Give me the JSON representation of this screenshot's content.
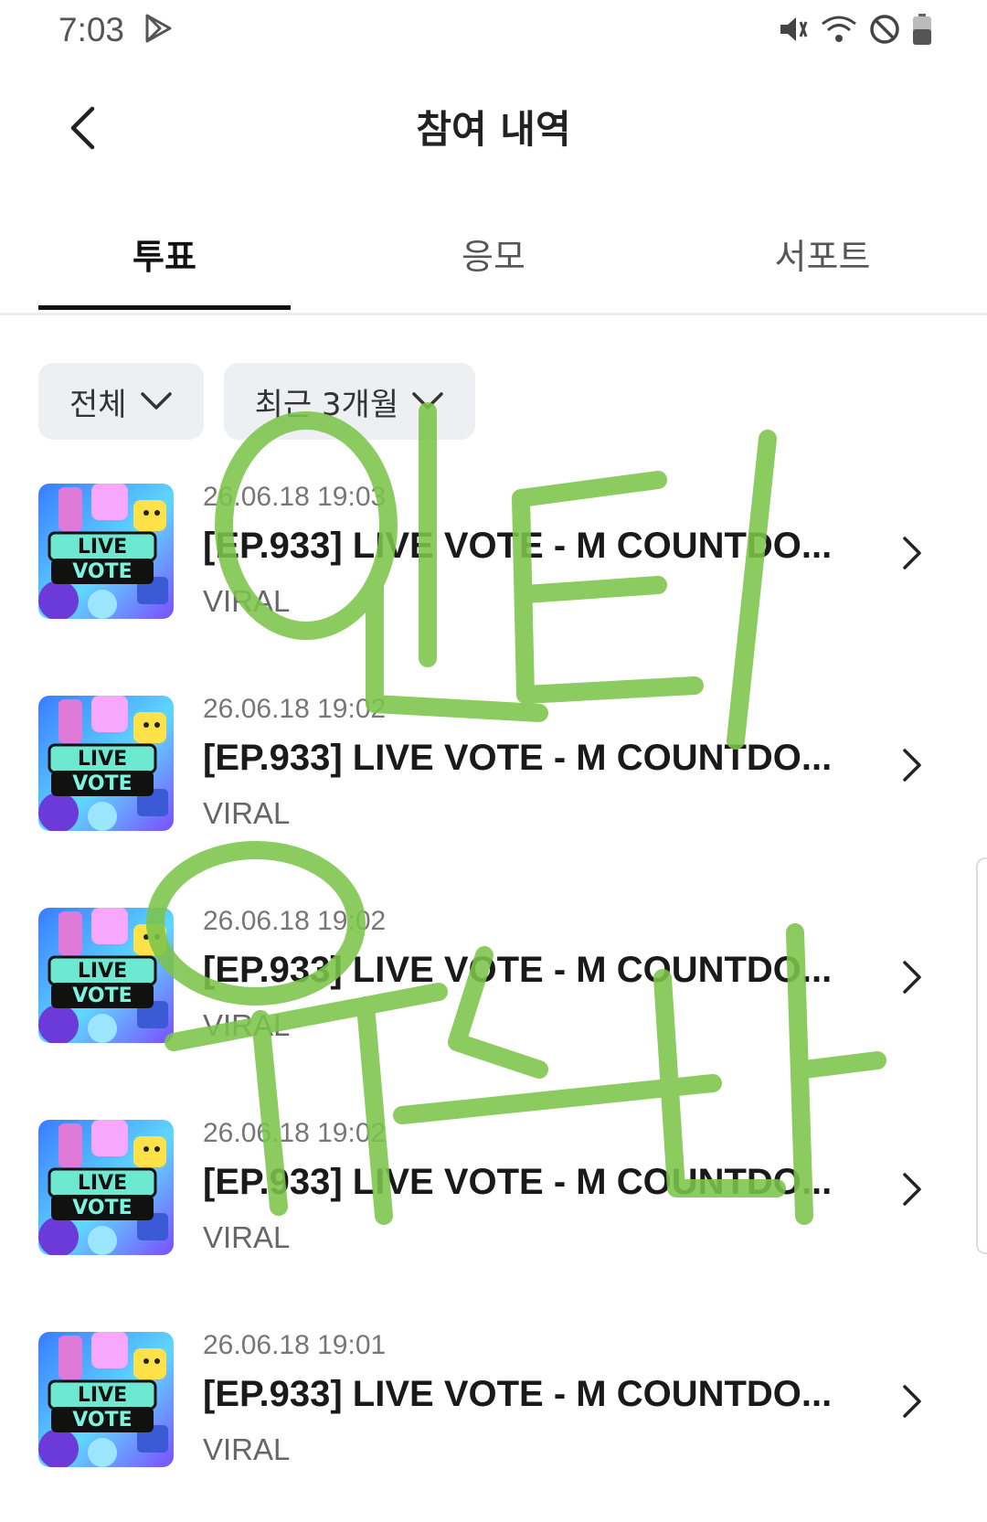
{
  "status_bar": {
    "time": "7:03",
    "icons": [
      "play-store-icon",
      "mute-vibrate-icon",
      "wifi-icon",
      "do-not-disturb-icon",
      "battery-icon"
    ]
  },
  "header": {
    "title": "참여 내역",
    "back_icon": "chevron-left-icon"
  },
  "tabs": [
    {
      "label": "투표",
      "active": true
    },
    {
      "label": "응모",
      "active": false
    },
    {
      "label": "서포트",
      "active": false
    }
  ],
  "filters": [
    {
      "label": "전체"
    },
    {
      "label": "최근 3개월"
    }
  ],
  "items": [
    {
      "date": "26.06.18 19:03",
      "title": "[EP.933] LIVE VOTE - M COUNTDO...",
      "category": "VIRAL"
    },
    {
      "date": "26.06.18 19:02",
      "title": "[EP.933] LIVE VOTE - M COUNTDO...",
      "category": "VIRAL"
    },
    {
      "date": "26.06.18 19:02",
      "title": "[EP.933] LIVE VOTE - M COUNTDO...",
      "category": "VIRAL"
    },
    {
      "date": "26.06.18 19:02",
      "title": "[EP.933] LIVE VOTE - M COUNTDO...",
      "category": "VIRAL"
    },
    {
      "date": "26.06.18 19:01",
      "title": "[EP.933] LIVE VOTE - M COUNTDO...",
      "category": "VIRAL"
    }
  ],
  "thumbnail_text": {
    "line1": "LIVE",
    "line2": "VOTE"
  },
  "colors": {
    "active_tab_underline": "#111111",
    "chip_background": "#eeeff2",
    "overlay_scribble": "#7cc44a"
  },
  "overlay_handwriting": {
    "line1": "인터",
    "line2": "유스나"
  }
}
